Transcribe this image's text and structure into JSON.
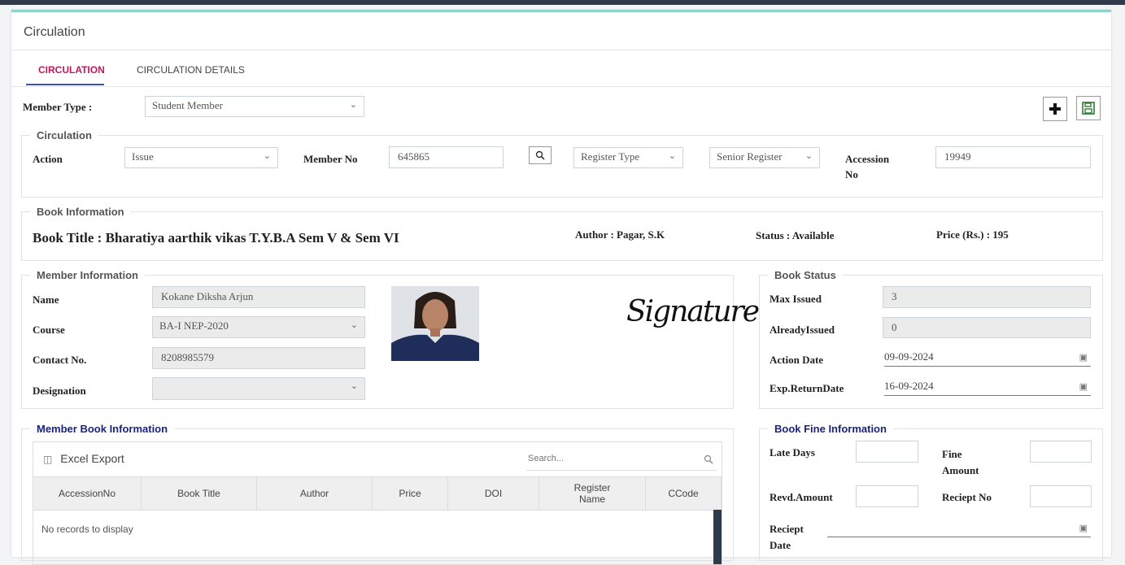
{
  "page": {
    "title": "Circulation"
  },
  "tabs": [
    {
      "label": "CIRCULATION",
      "active": true
    },
    {
      "label": "CIRCULATION DETAILS",
      "active": false
    }
  ],
  "member_type": {
    "label": "Member Type :",
    "value": "Student Member"
  },
  "toolbar": {
    "add_icon": "plus-icon",
    "save_icon": "floppy-disk-icon"
  },
  "circulation": {
    "legend": "Circulation",
    "action_label": "Action",
    "action_value": "Issue",
    "member_no_label": "Member No",
    "member_no_value": "645865",
    "register_type_value": "Register Type",
    "register_value": "Senior Register",
    "accession_label_1": "Accession",
    "accession_label_2": "No",
    "accession_value": "19949"
  },
  "book_info": {
    "legend": "Book Information",
    "title_text": "Book Title : Bharatiya aarthik vikas T.Y.B.A Sem V & Sem VI",
    "author_text": "Author : Pagar, S.K",
    "status_text": "Status : Available",
    "price_text": "Price (Rs.) : 195"
  },
  "member_info": {
    "legend": "Member Information",
    "name_label": "Name",
    "name_value": "Kokane Diksha Arjun",
    "course_label": "Course",
    "course_value": "BA-I NEP-2020",
    "contact_label": "Contact No.",
    "contact_value": "8208985579",
    "designation_label": "Designation",
    "designation_value": "",
    "signature_text": "Signature"
  },
  "book_status": {
    "legend": "Book Status",
    "max_issued_label": "Max Issued",
    "max_issued_value": "3",
    "already_issued_label": "AlreadyIssued",
    "already_issued_value": "0",
    "action_date_label": "Action Date",
    "action_date_value": "09-09-2024",
    "exp_return_label": "Exp.ReturnDate",
    "exp_return_value": "16-09-2024"
  },
  "member_book_info": {
    "legend": "Member Book Information",
    "excel_export": "Excel Export",
    "search_placeholder": "Search...",
    "columns": [
      "AccessionNo",
      "Book Title",
      "Author",
      "Price",
      "DOI",
      "Register Name",
      "CCode"
    ],
    "empty_text": "No records to display"
  },
  "fine_info": {
    "legend": "Book Fine Information",
    "late_days_label": "Late Days",
    "fine_amount_label_1": "Fine",
    "fine_amount_label_2": "Amount",
    "revd_amount_label": "Revd.Amount",
    "reciept_no_label": "Reciept No",
    "reciept_date_label_1": "Reciept",
    "reciept_date_label_2": "Date"
  },
  "colors": {
    "active_tab": "#c2185b",
    "tab_underline": "#3f51b5",
    "save_green": "#2e7d32",
    "panel_top": "#8fd3cf"
  }
}
